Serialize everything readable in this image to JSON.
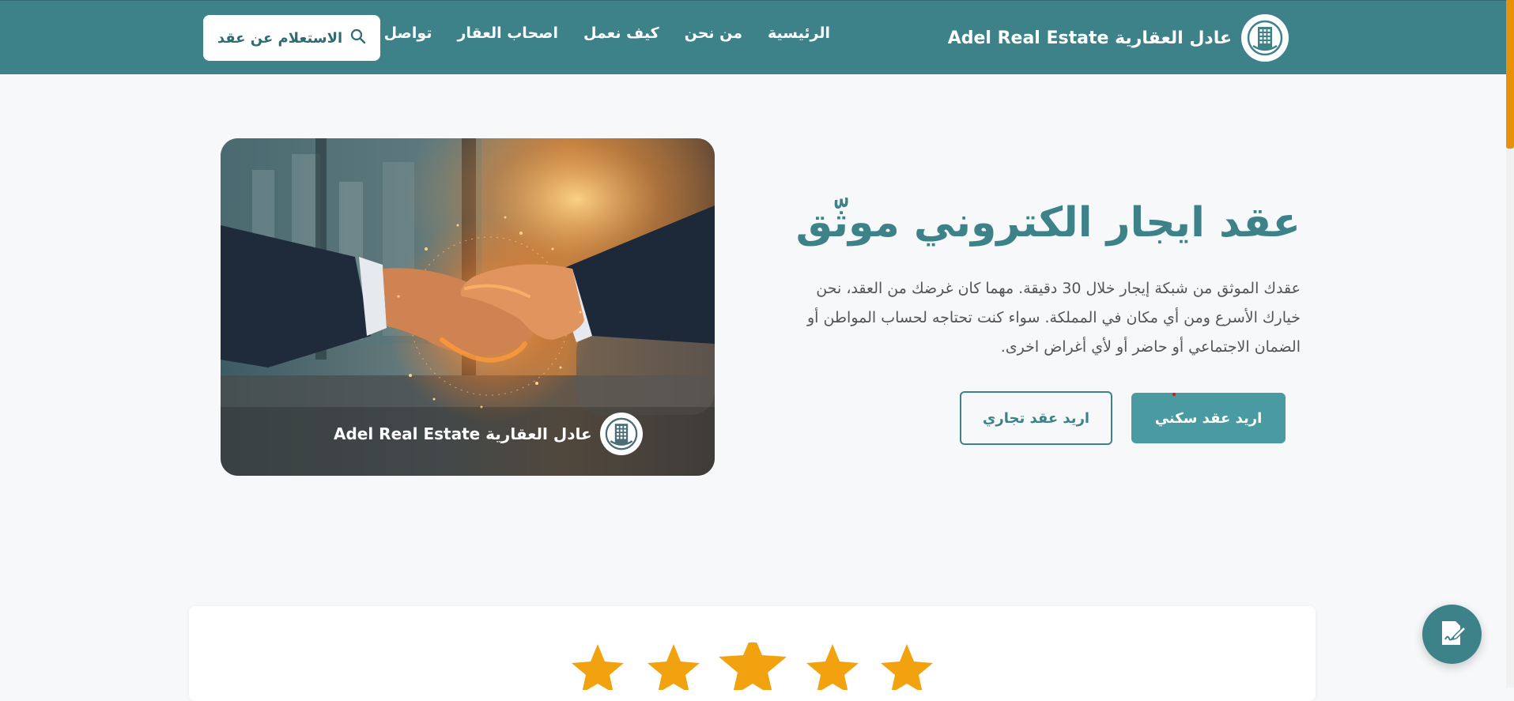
{
  "header": {
    "brand_name": "Adel Real Estate عادل العقارية",
    "nav": [
      {
        "label": "الرئيسية"
      },
      {
        "label": "من نحن"
      },
      {
        "label": "كيف نعمل"
      },
      {
        "label": "اصحاب العقار"
      },
      {
        "label": "تواصل معنا"
      }
    ],
    "inquiry_button": "الاستعلام عن عقد",
    "inquiry_icon": "search-icon"
  },
  "hero": {
    "title": "عقد ايجار الكتروني موثّق",
    "description": "عقدك الموثق من شبكة إيجار خلال 30 دقيقة. مهما كان غرضك من العقد، نحن خيارك الأسرع ومن أي مكان في المملكة. سواء كنت تحتاجه لحساب المواطن أو الضمان الاجتماعي أو حاضر أو لأي أغراض اخرى.",
    "primary_button": "اريد عقد سكني",
    "secondary_button": "اريد عقد تجاري",
    "image_brand": "Adel Real Estate عادل العقارية",
    "image_subject": "handshake-image"
  },
  "rating": {
    "stars": 5,
    "star_color": "#f3a20f"
  },
  "fab": {
    "icon": "contract-sign-icon"
  },
  "colors": {
    "primary": "#3d8289",
    "button": "#4a9aa2",
    "accent": "#e8920c"
  }
}
